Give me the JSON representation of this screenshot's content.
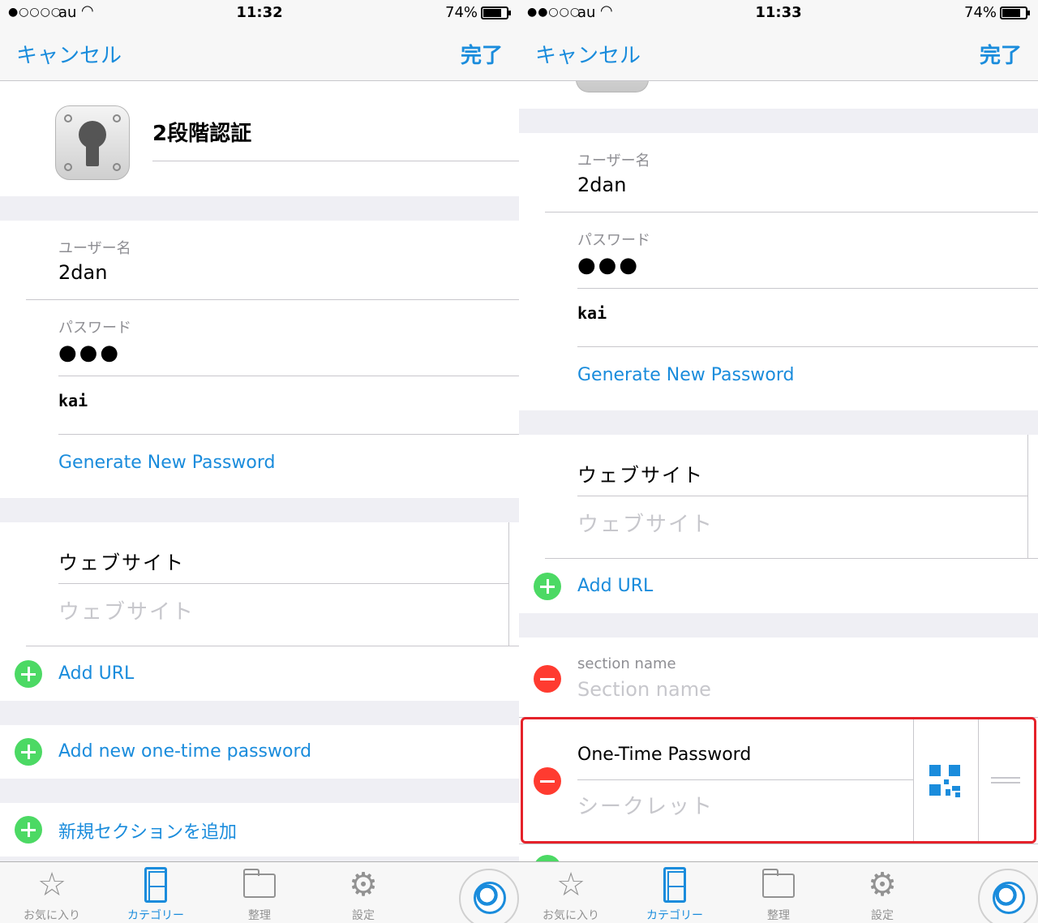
{
  "left": {
    "status": {
      "signal": "●○○○○",
      "carrier": "au",
      "time": "11:32",
      "battery": "74%"
    },
    "nav": {
      "cancel": "キャンセル",
      "done": "完了"
    },
    "item_title": "2段階認証",
    "username_label": "ユーザー名",
    "username_value": "2dan",
    "password_label": "パスワード",
    "password_value": "●●●",
    "password_hint": "kai",
    "generate_password": "Generate New Password",
    "website_label": "ウェブサイト",
    "website_placeholder": "ウェブサイト",
    "add_url": "Add URL",
    "add_otp": "Add new one-time password",
    "add_section": "新規セクションを追加"
  },
  "right": {
    "status": {
      "signal": "●●○○○",
      "carrier": "au",
      "time": "11:33",
      "battery": "74%"
    },
    "nav": {
      "cancel": "キャンセル",
      "done": "完了"
    },
    "username_label": "ユーザー名",
    "username_value": "2dan",
    "password_label": "パスワード",
    "password_value": "●●●",
    "password_hint": "kai",
    "generate_password": "Generate New Password",
    "website_label": "ウェブサイト",
    "website_placeholder": "ウェブサイト",
    "add_url": "Add URL",
    "section_name_label": "section name",
    "section_name_placeholder": "Section name",
    "otp_title": "One-Time Password",
    "otp_secret_placeholder": "シークレット"
  },
  "tabbar": {
    "favorites": "お気に入り",
    "categories": "カテゴリー",
    "organize": "整理",
    "settings": "設定"
  },
  "colors": {
    "accent": "#1a8cdc",
    "add": "#4cd964",
    "delete": "#ff3b30",
    "highlight": "#e5222a"
  }
}
